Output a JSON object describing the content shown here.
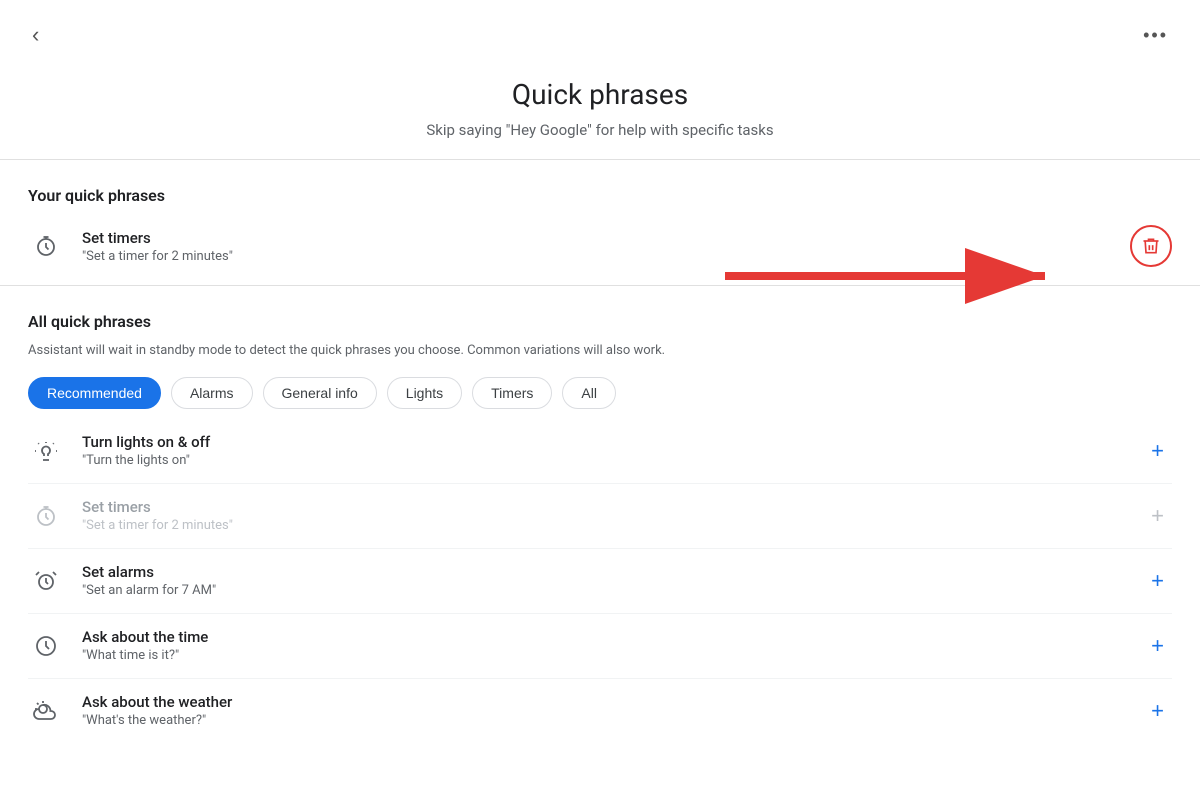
{
  "topBar": {
    "backLabel": "‹",
    "moreLabel": "•••"
  },
  "header": {
    "title": "Quick phrases",
    "subtitle": "Skip saying \"Hey Google\" for help with specific tasks"
  },
  "yourQuickPhrases": {
    "sectionTitle": "Your quick phrases",
    "items": [
      {
        "title": "Set timers",
        "subtitle": "\"Set a timer for 2 minutes\"",
        "icon": "timer-icon"
      }
    ]
  },
  "allQuickPhrases": {
    "sectionTitle": "All quick phrases",
    "description": "Assistant will wait in standby mode to detect the quick phrases you choose. Common variations will also work.",
    "filters": [
      {
        "label": "Recommended",
        "active": true
      },
      {
        "label": "Alarms",
        "active": false
      },
      {
        "label": "General info",
        "active": false
      },
      {
        "label": "Lights",
        "active": false
      },
      {
        "label": "Timers",
        "active": false
      },
      {
        "label": "All",
        "active": false
      }
    ],
    "items": [
      {
        "title": "Turn lights on & off",
        "subtitle": "\"Turn the lights on\"",
        "icon": "bulb-icon",
        "dimmed": false,
        "addLabel": "+"
      },
      {
        "title": "Set timers",
        "subtitle": "\"Set a timer for 2 minutes\"",
        "icon": "timer-icon",
        "dimmed": true,
        "addLabel": "+"
      },
      {
        "title": "Set alarms",
        "subtitle": "\"Set an alarm for 7 AM\"",
        "icon": "alarm-icon",
        "dimmed": false,
        "addLabel": "+"
      },
      {
        "title": "Ask about the time",
        "subtitle": "\"What time is it?\"",
        "icon": "clock-icon",
        "dimmed": false,
        "addLabel": "+"
      },
      {
        "title": "Ask about the weather",
        "subtitle": "\"What's the weather?\"",
        "icon": "weather-icon",
        "dimmed": false,
        "addLabel": "+"
      }
    ]
  },
  "colors": {
    "accent": "#1a73e8",
    "danger": "#e53935",
    "muted": "#5f6368"
  }
}
